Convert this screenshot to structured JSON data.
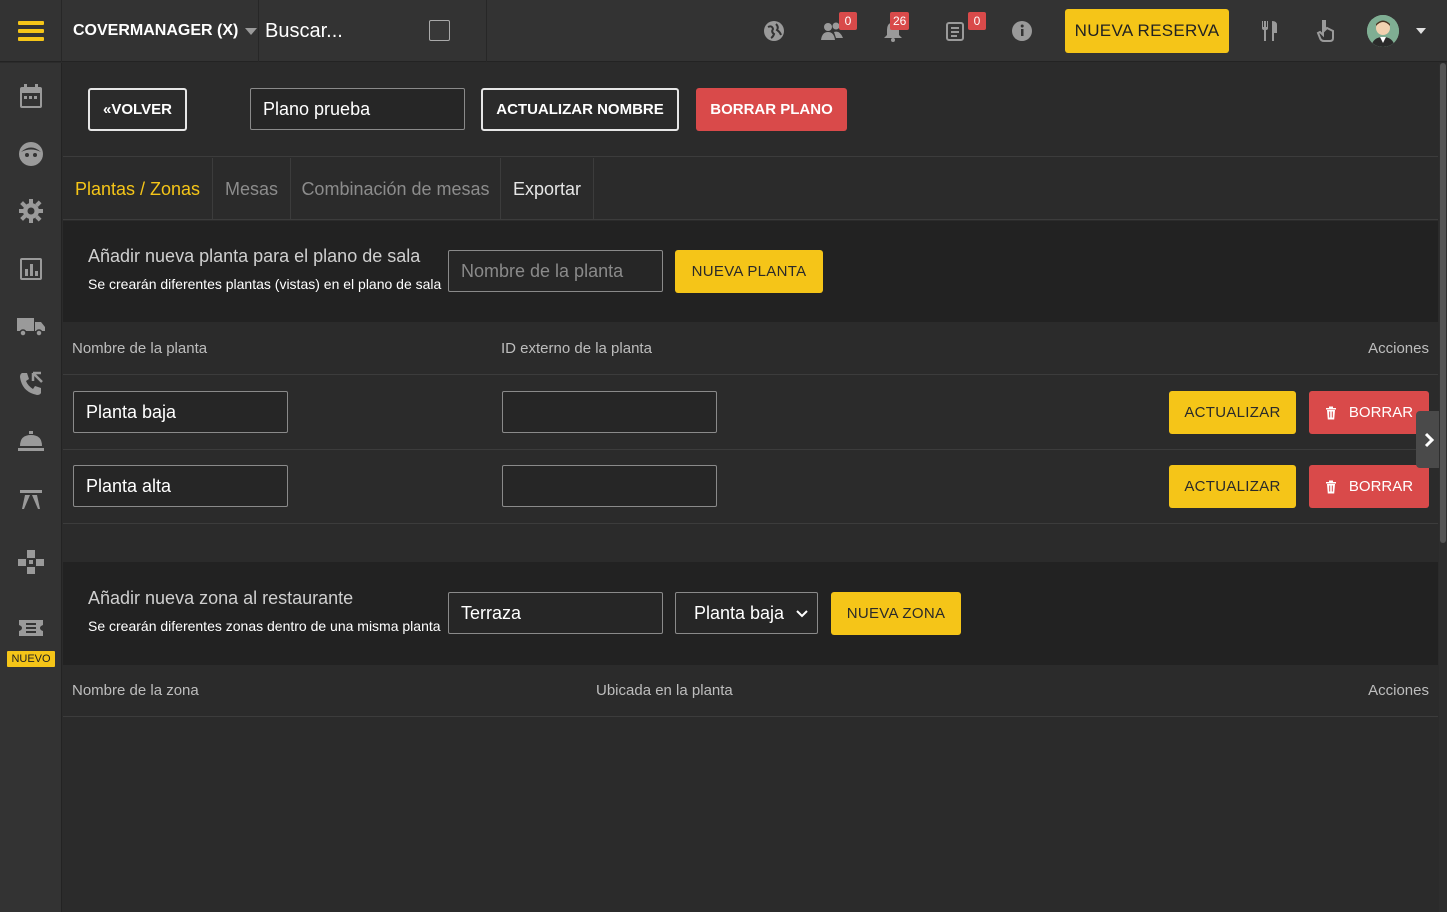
{
  "topbar": {
    "brand": "COVERMANAGER (X)",
    "search_placeholder": "Buscar...",
    "badges": {
      "people": "0",
      "bell": "26",
      "list": "0"
    },
    "nueva_reserva": "NUEVA RESERVA"
  },
  "sidebar": {
    "icons": [
      "calendar-icon",
      "guest-face-icon",
      "gear-icon",
      "stats-icon",
      "delivery-truck-icon",
      "phone-icon",
      "service-bell-icon",
      "table-icon",
      "gamepad-icon",
      "ticket-icon"
    ],
    "nuevo_badge": "NUEVO"
  },
  "toolbar": {
    "volver": "«VOLVER",
    "plan_name": "Plano prueba",
    "actualizar_nombre": "ACTUALIZAR NOMBRE",
    "borrar_plano": "BORRAR PLANO"
  },
  "tabs": [
    "Plantas / Zonas",
    "Mesas",
    "Combinación de mesas",
    "Exportar"
  ],
  "plantas": {
    "title": "Añadir nueva planta para el plano de sala",
    "subtitle": "Se crearán diferentes plantas (vistas) en el plano de sala",
    "input_placeholder": "Nombre de la planta",
    "nueva_planta": "NUEVA PLANTA",
    "headers": {
      "nombre": "Nombre de la planta",
      "id_externo": "ID externo de la planta",
      "acciones": "Acciones"
    },
    "rows": [
      {
        "nombre": "Planta baja",
        "id_externo": ""
      },
      {
        "nombre": "Planta alta",
        "id_externo": ""
      }
    ],
    "actualizar": "ACTUALIZAR",
    "borrar": "BORRAR"
  },
  "zonas": {
    "title": "Añadir nueva zona al restaurante",
    "subtitle": "Se crearán diferentes zonas dentro de una misma planta",
    "input_value": "Terraza",
    "select_value": "Planta baja",
    "nueva_zona": "NUEVA ZONA",
    "headers": {
      "nombre": "Nombre de la zona",
      "ubicada": "Ubicada en la planta",
      "acciones": "Acciones"
    }
  },
  "colors": {
    "accent": "#f5c518",
    "danger": "#d94a4a",
    "background": "#2b2b2b",
    "panel": "#222222"
  }
}
